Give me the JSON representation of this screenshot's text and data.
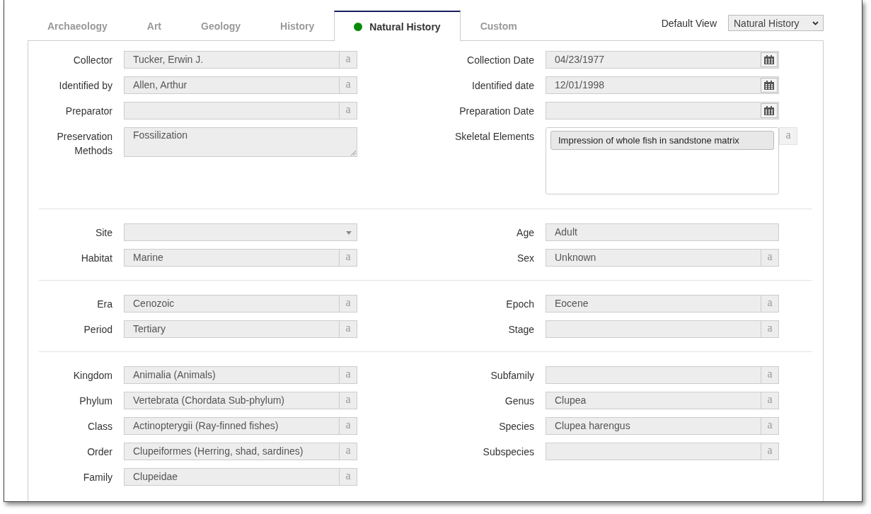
{
  "tabs": [
    {
      "label": "Archaeology",
      "selected": false
    },
    {
      "label": "Art",
      "selected": false
    },
    {
      "label": "Geology",
      "selected": false
    },
    {
      "label": "History",
      "selected": false
    },
    {
      "label": "Natural History",
      "selected": true,
      "color": "#0a8a0a"
    },
    {
      "label": "Custom",
      "selected": false
    }
  ],
  "default_view": {
    "label": "Default View",
    "value": "Natural History"
  },
  "sections": [
    {
      "left": [
        {
          "label": "Collector",
          "kind": "text",
          "value": "Tucker, Erwin J.",
          "addon": "a"
        },
        {
          "label": "Identified by",
          "kind": "text",
          "value": "Allen, Arthur",
          "addon": "a"
        },
        {
          "label": "Preparator",
          "kind": "text",
          "addon": "a"
        },
        {
          "label": "Preservation Methods",
          "kind": "textarea",
          "value": "Fossilization"
        }
      ],
      "right": [
        {
          "label": "Collection Date",
          "kind": "date",
          "value": "04/23/1977"
        },
        {
          "label": "Identified date",
          "kind": "date",
          "value": "12/01/1998"
        },
        {
          "label": "Preparation Date",
          "kind": "date"
        },
        {
          "label": "Skeletal Elements",
          "kind": "tags",
          "tags": [
            "Impression of whole fish in sandstone matrix"
          ],
          "addon": "a"
        }
      ]
    },
    {
      "left": [
        {
          "label": "Site",
          "kind": "select"
        },
        {
          "label": "Habitat",
          "kind": "text",
          "value": "Marine",
          "addon": "a"
        }
      ],
      "right": [
        {
          "label": "Age",
          "kind": "text",
          "value": "Adult"
        },
        {
          "label": "Sex",
          "kind": "text",
          "value": "Unknown",
          "addon": "a"
        }
      ]
    },
    {
      "left": [
        {
          "label": "Era",
          "kind": "text",
          "value": "Cenozoic",
          "addon": "a"
        },
        {
          "label": "Period",
          "kind": "text",
          "value": "Tertiary",
          "addon": "a"
        }
      ],
      "right": [
        {
          "label": "Epoch",
          "kind": "text",
          "value": "Eocene",
          "addon": "a"
        },
        {
          "label": "Stage",
          "kind": "text",
          "addon": "a"
        }
      ]
    },
    {
      "left": [
        {
          "label": "Kingdom",
          "kind": "text",
          "value": "Animalia (Animals)",
          "addon": "a"
        },
        {
          "label": "Phylum",
          "kind": "text",
          "value": "Vertebrata (Chordata Sub-phylum)",
          "addon": "a"
        },
        {
          "label": "Class",
          "kind": "text",
          "value": "Actinopterygii (Ray-finned fishes)",
          "addon": "a"
        },
        {
          "label": "Order",
          "kind": "text",
          "value": "Clupeiformes (Herring, shad, sardines)",
          "addon": "a"
        },
        {
          "label": "Family",
          "kind": "text",
          "value": "Clupeidae",
          "addon": "a"
        }
      ],
      "right": [
        {
          "label": "Subfamily",
          "kind": "text",
          "addon": "a"
        },
        {
          "label": "Genus",
          "kind": "text",
          "value": "Clupea",
          "addon": "a"
        },
        {
          "label": "Species",
          "kind": "text",
          "value": "Clupea harengus",
          "addon": "a"
        },
        {
          "label": "Subspecies",
          "kind": "text",
          "addon": "a"
        }
      ]
    }
  ]
}
